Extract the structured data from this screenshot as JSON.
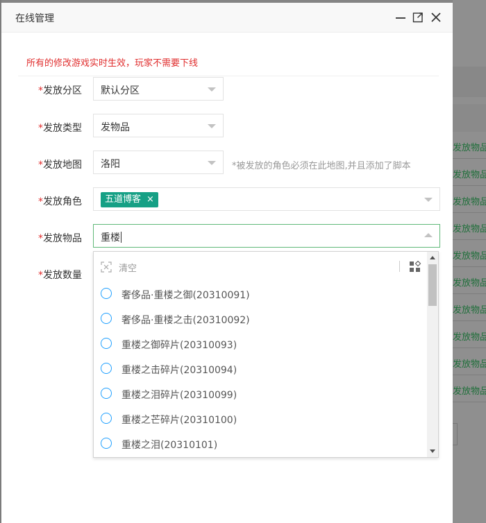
{
  "modal": {
    "title": "在线管理",
    "notice": "所有的修改游戏实时生效，玩家不需要下线"
  },
  "form": {
    "required_mark": "*",
    "zone": {
      "label": "发放分区",
      "value": "默认分区"
    },
    "type": {
      "label": "发放类型",
      "value": "发物品"
    },
    "map": {
      "label": "发放地图",
      "value": "洛阳",
      "hint": "*被发放的角色必须在此地图,并且添加了脚本"
    },
    "role": {
      "label": "发放角色",
      "tag": "五道博客",
      "tag_close": "×"
    },
    "item": {
      "label": "发放物品",
      "search": "重楼"
    },
    "quantity": {
      "label": "发放数量"
    }
  },
  "dropdown": {
    "clear_label": "清空",
    "options": [
      "奢侈品·重楼之御(20310091)",
      "奢侈品·重楼之击(20310092)",
      "重楼之御碎片(20310093)",
      "重楼之击碎片(20310094)",
      "重楼之泪碎片(20310099)",
      "重楼之芒碎片(20310100)",
      "重楼之泪(20310101)"
    ]
  },
  "background": {
    "link_text": "发放物品"
  },
  "colors": {
    "required": "#e02d2d",
    "tag_bg": "#16a085",
    "radio": "#1e9fff",
    "link": "#1f6f3a"
  }
}
